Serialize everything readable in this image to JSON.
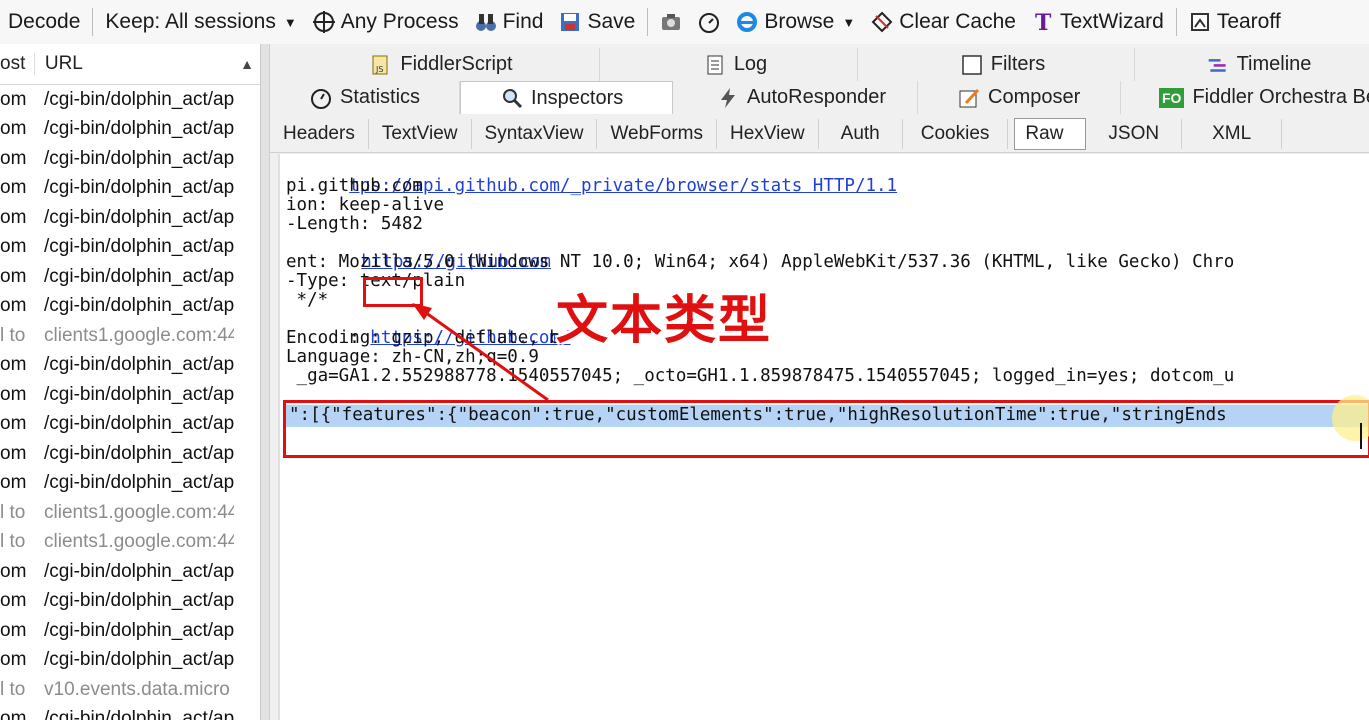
{
  "toolbar": {
    "items": [
      {
        "label": "Decode",
        "icon": "decode-icon"
      },
      {
        "label": "Keep: All sessions",
        "icon": "",
        "caret": "▾"
      },
      {
        "label": "Any Process",
        "icon": "crosshair-icon"
      },
      {
        "label": "Find",
        "icon": "binoculars-icon"
      },
      {
        "label": "Save",
        "icon": "save-icon"
      },
      {
        "label": "",
        "icon": "camera-icon"
      },
      {
        "label": "",
        "icon": "timer-icon"
      },
      {
        "label": "Browse",
        "icon": "ie-icon",
        "caret": "▾"
      },
      {
        "label": "Clear Cache",
        "icon": "clear-cache-icon"
      },
      {
        "label": "TextWizard",
        "icon": "textwizard-icon"
      },
      {
        "label": "Tearoff",
        "icon": "tearoff-icon"
      }
    ]
  },
  "sessions": {
    "header": {
      "host": "ost",
      "url": "URL"
    },
    "rows": [
      {
        "host": "om",
        "url": "/cgi-bin/dolphin_act/ap",
        "grey": false
      },
      {
        "host": "om",
        "url": "/cgi-bin/dolphin_act/ap",
        "grey": false
      },
      {
        "host": "om",
        "url": "/cgi-bin/dolphin_act/ap",
        "grey": false
      },
      {
        "host": "om",
        "url": "/cgi-bin/dolphin_act/ap",
        "grey": false
      },
      {
        "host": "om",
        "url": "/cgi-bin/dolphin_act/ap",
        "grey": false
      },
      {
        "host": "om",
        "url": "/cgi-bin/dolphin_act/ap",
        "grey": false
      },
      {
        "host": "om",
        "url": "/cgi-bin/dolphin_act/ap",
        "grey": false
      },
      {
        "host": "om",
        "url": "/cgi-bin/dolphin_act/ap",
        "grey": false
      },
      {
        "host": "l to",
        "url": "clients1.google.com:44",
        "grey": true
      },
      {
        "host": "om",
        "url": "/cgi-bin/dolphin_act/ap",
        "grey": false
      },
      {
        "host": "om",
        "url": "/cgi-bin/dolphin_act/ap",
        "grey": false
      },
      {
        "host": "om",
        "url": "/cgi-bin/dolphin_act/ap",
        "grey": false
      },
      {
        "host": "om",
        "url": "/cgi-bin/dolphin_act/ap",
        "grey": false
      },
      {
        "host": "om",
        "url": "/cgi-bin/dolphin_act/ap",
        "grey": false
      },
      {
        "host": "l to",
        "url": "clients1.google.com:44",
        "grey": true
      },
      {
        "host": "l to",
        "url": "clients1.google.com:44",
        "grey": true
      },
      {
        "host": "om",
        "url": "/cgi-bin/dolphin_act/ap",
        "grey": false
      },
      {
        "host": "om",
        "url": "/cgi-bin/dolphin_act/ap",
        "grey": false
      },
      {
        "host": "om",
        "url": "/cgi-bin/dolphin_act/ap",
        "grey": false
      },
      {
        "host": "om",
        "url": "/cgi-bin/dolphin_act/ap",
        "grey": false
      },
      {
        "host": "l to",
        "url": "v10.events.data.micro",
        "grey": true
      },
      {
        "host": "om",
        "url": "/cgi-bin/dolphin_act/ap",
        "grey": false
      }
    ]
  },
  "tabs_top": [
    {
      "label": "FiddlerScript",
      "icon": "script-icon"
    },
    {
      "label": "Log",
      "icon": "log-icon"
    },
    {
      "label": "Filters",
      "icon": "checkbox-icon"
    },
    {
      "label": "Timeline",
      "icon": "timeline-icon"
    }
  ],
  "tabs_main": [
    {
      "label": "Statistics",
      "icon": "stopwatch-icon"
    },
    {
      "label": "Inspectors",
      "icon": "inspector-icon",
      "active": true
    },
    {
      "label": "AutoResponder",
      "icon": "lightning-icon"
    },
    {
      "label": "Composer",
      "icon": "composer-icon"
    },
    {
      "label": "Fiddler Orchestra Be",
      "icon": "fo-icon",
      "badge": "FO"
    }
  ],
  "subtabs": [
    {
      "label": "Headers"
    },
    {
      "label": "TextView"
    },
    {
      "label": "SyntaxView"
    },
    {
      "label": "WebForms"
    },
    {
      "label": "HexView"
    },
    {
      "label": "Auth"
    },
    {
      "label": "Cookies"
    },
    {
      "label": "Raw",
      "active": true
    },
    {
      "label": "JSON"
    },
    {
      "label": "XML"
    }
  ],
  "raw": {
    "line1_link": "tps://api.github.com/_private/browser/stats HTTP/1.1",
    "line2": "pi.github.com",
    "line3": "ion: keep-alive",
    "line4": "-Length: 5482",
    "line5_link": "https://github.com",
    "line6": "ent: Mozilla/5.0 (Windows NT 10.0; Win64; x64) AppleWebKit/537.36 (KHTML, like Gecko) Chro",
    "line7": "-Type: text/plain",
    "line8": " */*",
    "line9_prefix": ": ",
    "line9_link": "https://github.com/",
    "line10": "Encoding: gzip, deflate, br",
    "line11": "Language: zh-CN,zh;q=0.9",
    "line12": " _ga=GA1.2.552988778.1540557045; _octo=GH1.1.859878475.1540557045; logged_in=yes; dotcom_u",
    "body": "\":[{\"features\":{\"beacon\":true,\"customElements\":true,\"highResolutionTime\":true,\"stringEnds"
  },
  "annotation": {
    "text": "文本类型",
    "color": "#e01010"
  }
}
